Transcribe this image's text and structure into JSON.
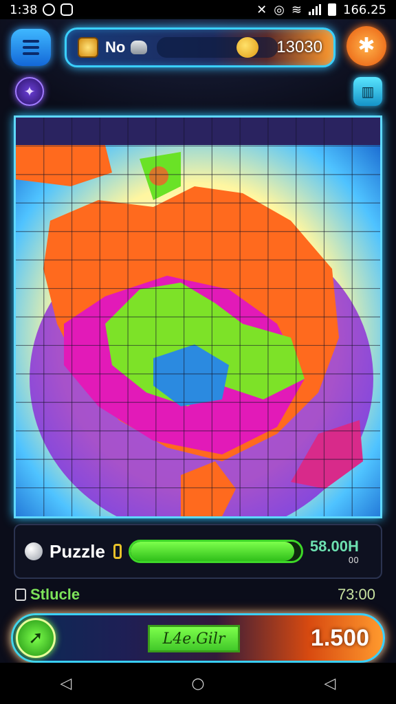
{
  "status_bar": {
    "time": "1:38",
    "battery_text": "166.25",
    "left_icons": [
      "notification-circle-icon",
      "notification-square-icon"
    ],
    "right_icons": [
      "mute-icon",
      "alarm-icon",
      "wifi-icon",
      "signal-icon",
      "battery-icon"
    ]
  },
  "top_bar": {
    "label": "No",
    "value": "13030",
    "icons": [
      "menu-icon",
      "coin-icon",
      "stone-icon",
      "emoji-icon",
      "settings-icon",
      "portal-icon",
      "gallery-icon"
    ]
  },
  "board": {
    "grid_rows": 14,
    "grid_cols": 13,
    "colors": {
      "border": "#5fd8ff",
      "ring": "#8a1bd8",
      "orange": "#ff6a1e",
      "magenta": "#e21ab8",
      "green": "#7de228",
      "blue": "#2b8ae0"
    }
  },
  "progress": {
    "label": "Puzzle",
    "value": "58.00H",
    "sub": "00",
    "percent": 96
  },
  "status": {
    "label": "Stlucle",
    "time": "73:00"
  },
  "action": {
    "level": "L4e.Gilr",
    "value": "1.500"
  },
  "nav": {
    "back": "◁",
    "home": "○",
    "recent": "◁"
  },
  "accent_colors": {
    "cyan": "#3ad0ff",
    "orange": "#ff7a22",
    "green": "#7dff4c"
  }
}
